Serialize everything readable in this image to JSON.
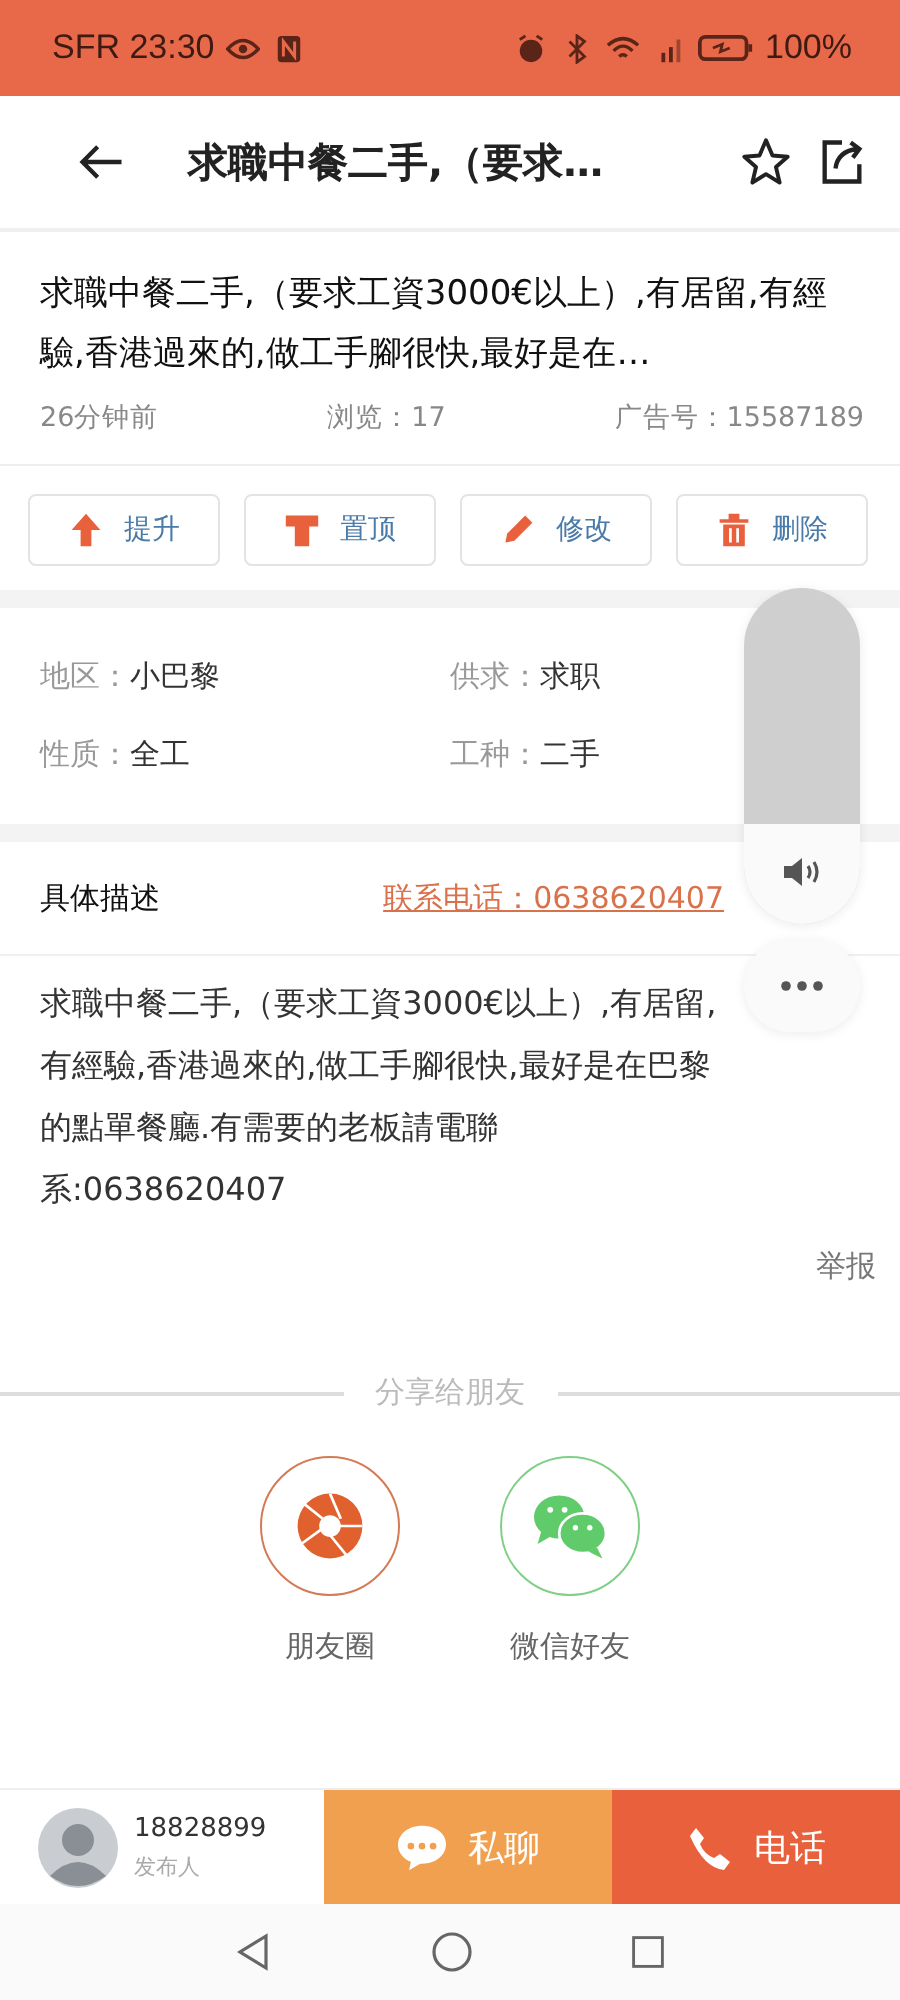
{
  "status_bar": {
    "carrier": "SFR",
    "time": "23:30",
    "battery": "100%"
  },
  "header": {
    "title": "求職中餐二手,（要求…"
  },
  "post": {
    "title": "求職中餐二手,（要求工資3000€以上）,有居留,有經驗,香港過來的,做工手腳很快,最好是在…",
    "time": "26分钟前",
    "views": "浏览：17",
    "ad_number": "广告号：15587189"
  },
  "actions": [
    {
      "kind": "up",
      "label": "提升"
    },
    {
      "kind": "shirt",
      "label": "置顶"
    },
    {
      "kind": "pencil",
      "label": "修改"
    },
    {
      "kind": "trash",
      "label": "删除"
    }
  ],
  "info": [
    {
      "label": "地区：",
      "value": "小巴黎"
    },
    {
      "label": "供求：",
      "value": "求职"
    },
    {
      "label": "性质：",
      "value": "全工"
    },
    {
      "label": "工种：",
      "value": "二手"
    }
  ],
  "description": {
    "heading": "具体描述",
    "phone_link": "联系电话：0638620407",
    "body": "求職中餐二手,（要求工資3000€以上）,有居留,有經驗,香港過來的,做工手腳很快,最好是在巴黎的點單餐廳.有需要的老板請電聯系:0638620407",
    "report": "举报"
  },
  "share": {
    "heading": "分享给朋友",
    "targets": [
      {
        "kind": "moments",
        "label": "朋友圈"
      },
      {
        "kind": "wechat",
        "label": "微信好友"
      }
    ]
  },
  "publisher": {
    "name": "18828899",
    "role": "发布人"
  },
  "bottom_buttons": [
    {
      "kind": "chat",
      "label": "私聊"
    },
    {
      "kind": "phone",
      "label": "电话"
    }
  ],
  "volume_panel": {
    "level": 0.3
  }
}
